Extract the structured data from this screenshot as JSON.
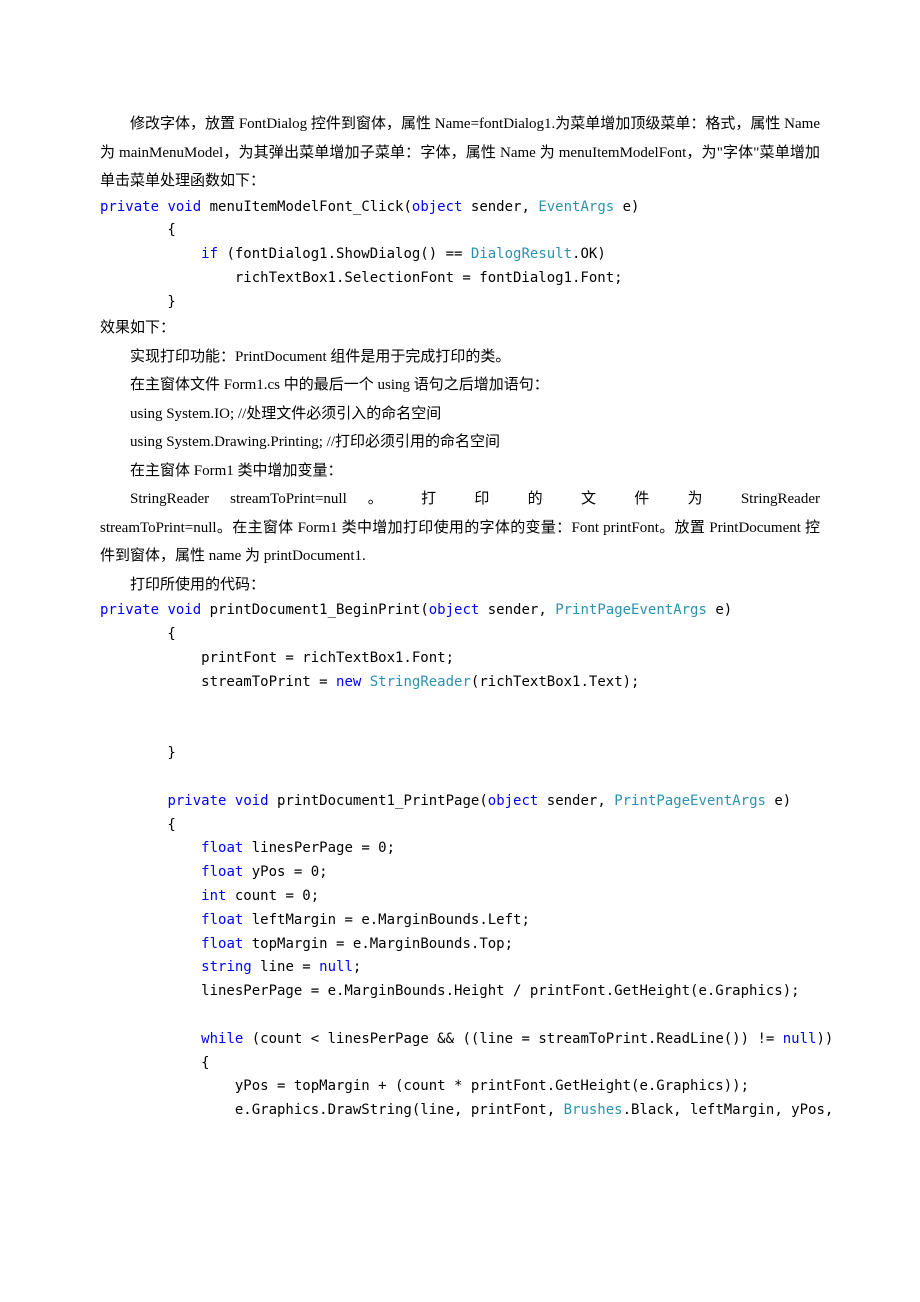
{
  "p1": "修改字体，放置 FontDialog 控件到窗体，属性 Name=fontDialog1.为菜单增加顶级菜单：格式，属性 Name 为 mainMenuModel，为其弹出菜单增加子菜单：字体，属性 Name 为 menuItemModelFont，为\"字体\"菜单增加单击菜单处理函数如下：",
  "c1a": "private",
  "c1b": " ",
  "c1c": "void",
  "c1d": " menuItemModelFont_Click(",
  "c1e": "object",
  "c1f": " sender, ",
  "c1g": "EventArgs",
  "c1h": " e)",
  "c2": "        {",
  "c3a": "            ",
  "c3b": "if",
  "c3c": " (fontDialog1.ShowDialog() == ",
  "c3d": "DialogResult",
  "c3e": ".OK)",
  "c4": "                richTextBox1.SelectionFont = fontDialog1.Font;",
  "c5": "        }",
  "p2": "效果如下：",
  "p3": "实现打印功能：PrintDocument 组件是用于完成打印的类。",
  "p4": "在主窗体文件 Form1.cs 中的最后一个 using 语句之后增加语句：",
  "p5": "using System.IO;      //处理文件必须引入的命名空间",
  "p6": "using System.Drawing.Printing; //打印必须引用的命名空间",
  "p7": " 在主窗体 Form1 类中增加变量：",
  "p8a": "StringReader",
  "p8b": "streamToPrint=null",
  "p8c": "。",
  "p8d": "打",
  "p8e": "印",
  "p8f": "的",
  "p8g": "文",
  "p8h": "件",
  "p8i": "为",
  "p8j": "StringReader",
  "p9": "streamToPrint=null。在主窗体 Form1 类中增加打印使用的字体的变量：Font printFont。放置 PrintDocument 控件到窗体，属性 name 为 printDocument1.",
  "p10": "打印所使用的代码：",
  "d1a": "private",
  "d1b": " ",
  "d1c": "void",
  "d1d": " printDocument1_BeginPrint(",
  "d1e": "object",
  "d1f": " sender, ",
  "d1g": "PrintPageEventArgs",
  "d1h": " e)",
  "d2": "        {",
  "d3": "            printFont = richTextBox1.Font;",
  "d4a": "            streamToPrint = ",
  "d4b": "new",
  "d4c": " ",
  "d4d": "StringReader",
  "d4e": "(richTextBox1.Text);",
  "d5": "        }",
  "e1a": "        ",
  "e1b": "private",
  "e1c": " ",
  "e1d": "void",
  "e1e": " printDocument1_PrintPage(",
  "e1f": "object",
  "e1g": " sender, ",
  "e1h": "PrintPageEventArgs",
  "e1i": " e)",
  "e2": "        {",
  "e3a": "            ",
  "e3b": "float",
  "e3c": " linesPerPage = 0;",
  "e4a": "            ",
  "e4b": "float",
  "e4c": " yPos = 0;",
  "e5a": "            ",
  "e5b": "int",
  "e5c": " count = 0;",
  "e6a": "            ",
  "e6b": "float",
  "e6c": " leftMargin = e.MarginBounds.Left;",
  "e7a": "            ",
  "e7b": "float",
  "e7c": " topMargin = e.MarginBounds.Top;",
  "e8a": "            ",
  "e8b": "string",
  "e8c": " line = ",
  "e8d": "null",
  "e8e": ";",
  "e9": "            linesPerPage = e.MarginBounds.Height / printFont.GetHeight(e.Graphics);",
  "e10a": "            ",
  "e10b": "while",
  "e10c": " (count < linesPerPage && ((line = streamToPrint.ReadLine()) != ",
  "e10d": "null",
  "e10e": "))",
  "e11": "            {",
  "e12": "                yPos = topMargin + (count * printFont.GetHeight(e.Graphics));",
  "e13a": "                e.Graphics.DrawString(line, printFont, ",
  "e13b": "Brushes",
  "e13c": ".Black, leftMargin, yPos,"
}
